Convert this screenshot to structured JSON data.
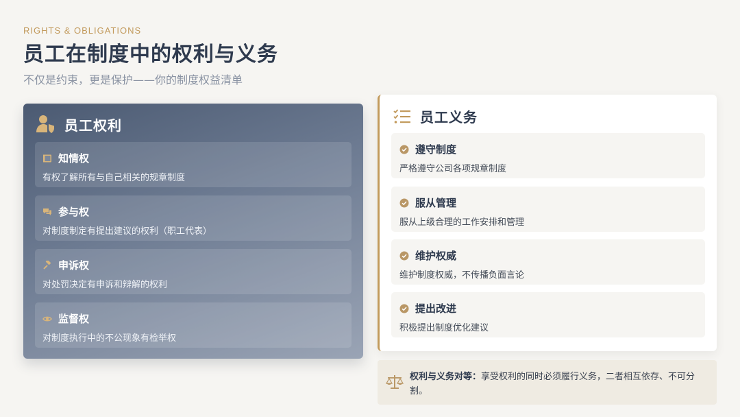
{
  "header": {
    "eyebrow": "RIGHTS & OBLIGATIONS",
    "title": "员工在制度中的权利与义务",
    "subtitle": "不仅是约束，更是保护——你的制度权益清单"
  },
  "rights": {
    "title": "员工权利",
    "icon": "user-shield-icon",
    "items": [
      {
        "name": "知情权",
        "desc": "有权了解所有与自己相关的规章制度",
        "icon": "book-icon"
      },
      {
        "name": "参与权",
        "desc": "对制度制定有提出建议的权利（职工代表）",
        "icon": "comments-icon"
      },
      {
        "name": "申诉权",
        "desc": "对处罚决定有申诉和辩解的权利",
        "icon": "gavel-icon"
      },
      {
        "name": "监督权",
        "desc": "对制度执行中的不公现象有检举权",
        "icon": "eye-icon"
      }
    ]
  },
  "obligations": {
    "title": "员工义务",
    "icon": "list-check-icon",
    "items": [
      {
        "name": "遵守制度",
        "desc": "严格遵守公司各项规章制度"
      },
      {
        "name": "服从管理",
        "desc": "服从上级合理的工作安排和管理"
      },
      {
        "name": "维护权威",
        "desc": "维护制度权威，不传播负面言论"
      },
      {
        "name": "提出改进",
        "desc": "积极提出制度优化建议"
      }
    ]
  },
  "note": {
    "label": "权利与义务对等：",
    "text": "享受权利的同时必须履行义务，二者相互依存、不可分割。",
    "icon": "balance-scale-icon"
  },
  "colors": {
    "accent": "#c29a5c",
    "navy": "#2e3a4e",
    "card_gradient_start": "#4b5a72",
    "card_gradient_end": "#9aa4b5"
  }
}
